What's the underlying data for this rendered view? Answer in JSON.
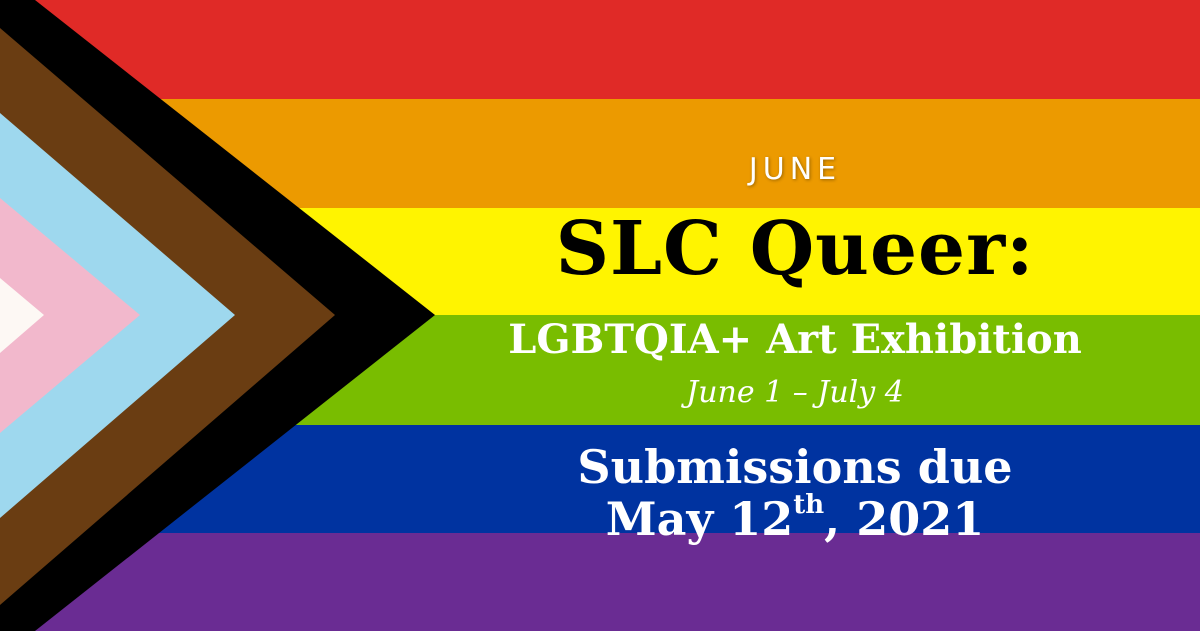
{
  "flag": {
    "stripe_colors": [
      "#e02a27",
      "#ec9a00",
      "#fff400",
      "#79bd00",
      "#0033a0",
      "#6a2c93"
    ],
    "chevron_colors": [
      "#000000",
      "#6a3d12",
      "#9ed8ee",
      "#f2b8cc",
      "#fdf8f4"
    ]
  },
  "announcement": {
    "month": "JUNE",
    "title": "SLC Queer:",
    "subtitle": "LGBTQIA+ Art Exhibition",
    "dates": "June 1 – July 4",
    "submissions_line1": "Submissions due",
    "deadline_day": "May 12",
    "deadline_suffix": "th",
    "deadline_year": ", 2021"
  }
}
